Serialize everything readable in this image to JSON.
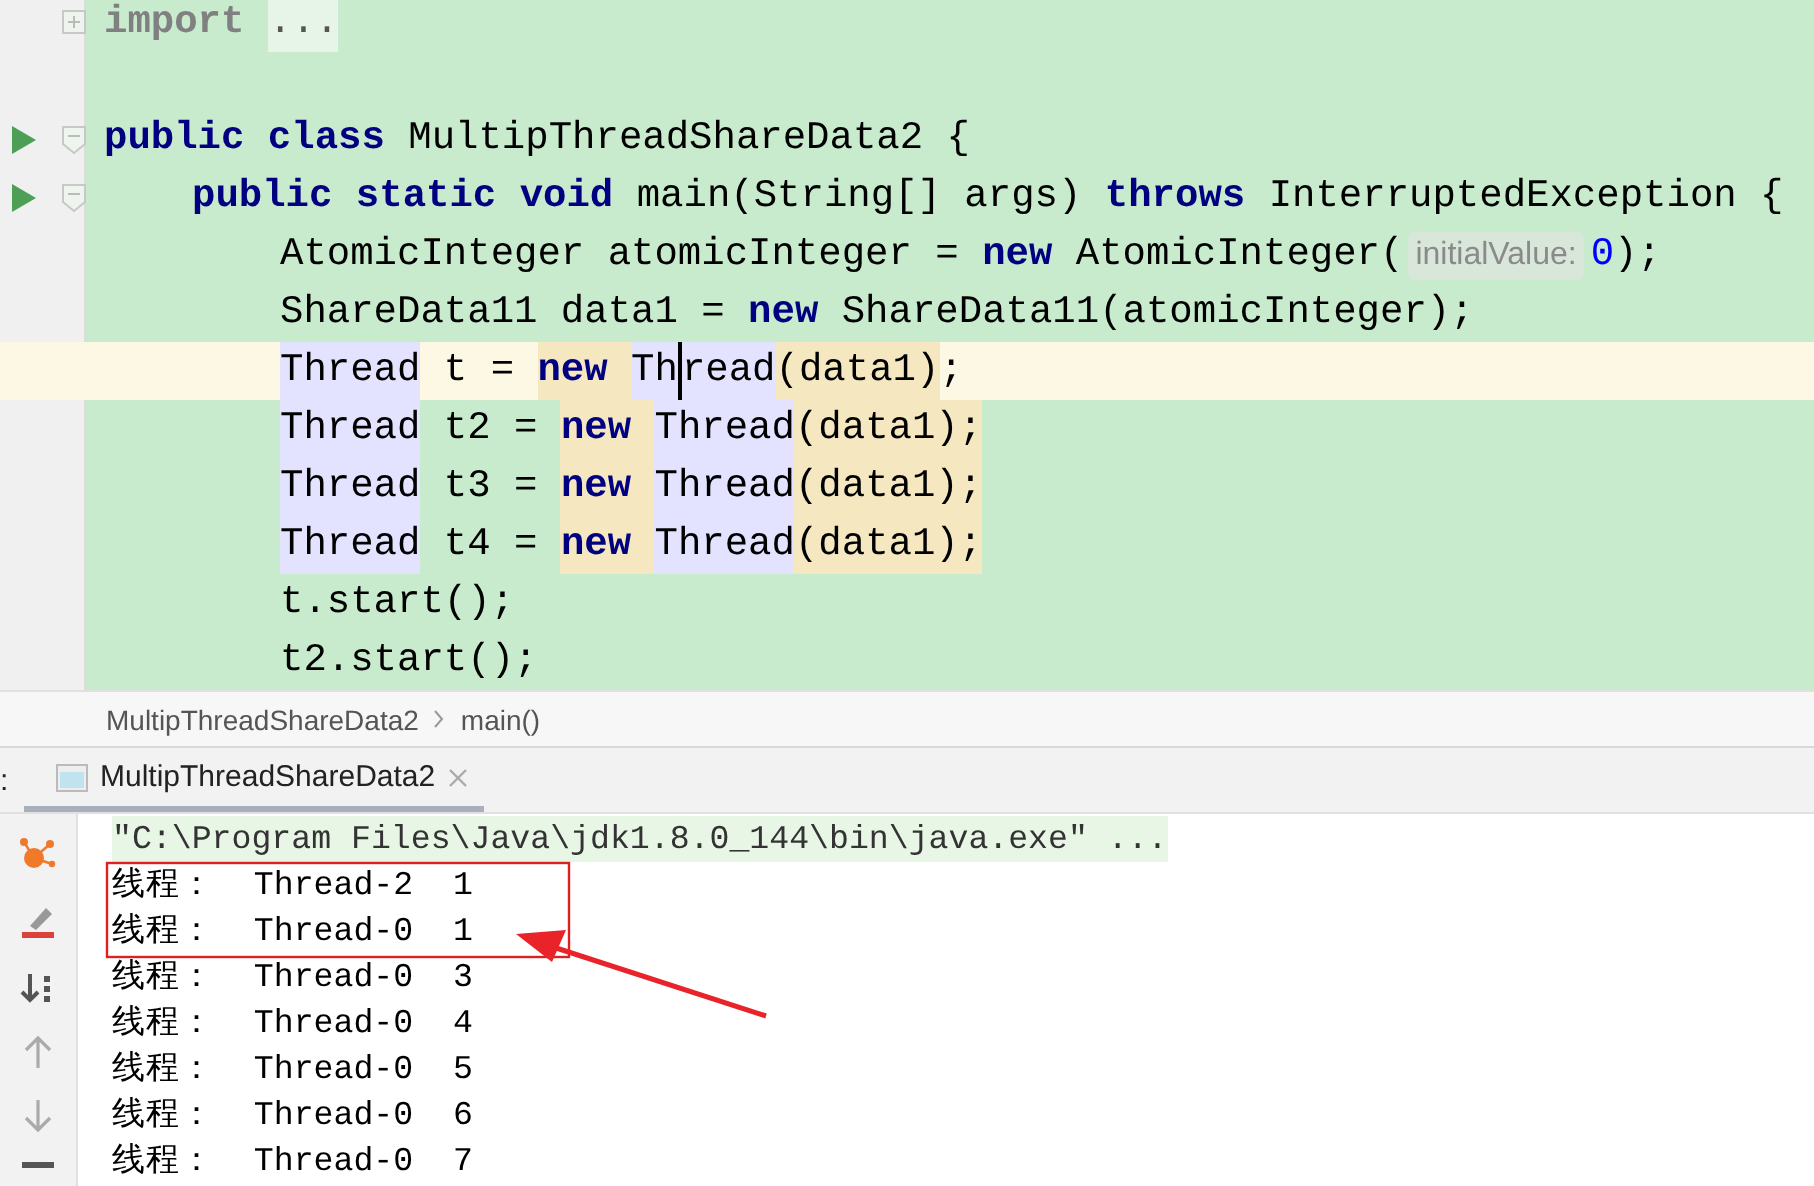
{
  "editor": {
    "lines": [
      {
        "collapsed": true,
        "tokens": [
          {
            "t": "import",
            "kind": "folded"
          },
          {
            "t": "...",
            "kind": "placeholder"
          }
        ]
      },
      {
        "run": true,
        "collapsed": false,
        "blank_before": true,
        "tokens": [
          {
            "t": "public class ",
            "kind": "keyword"
          },
          {
            "t": "MultipThreadShareData2 {",
            "kind": "plain"
          }
        ],
        "children": [
          {
            "run": true,
            "collapsed": false,
            "tokens": [
              {
                "t": "public static void ",
                "kind": "keyword"
              },
              {
                "t": "main(String[] args) ",
                "kind": "plain"
              },
              {
                "t": "throws ",
                "kind": "keyword"
              },
              {
                "t": "InterruptedException {",
                "kind": "plain"
              }
            ],
            "children": [
              {
                "tokens": [
                  {
                    "t": "AtomicInteger atomicInteger = ",
                    "kind": "plain"
                  },
                  {
                    "t": "new ",
                    "kind": "keyword"
                  },
                  {
                    "t": "AtomicInteger(",
                    "kind": "plain"
                  },
                  {
                    "t": "initialValue:",
                    "kind": "hint"
                  },
                  {
                    "t": "0",
                    "kind": "number"
                  },
                  {
                    "t": ");",
                    "kind": "plain"
                  }
                ]
              },
              {
                "tokens": [
                  {
                    "t": "ShareData11 data1 = ",
                    "kind": "plain"
                  },
                  {
                    "t": "new ",
                    "kind": "keyword"
                  },
                  {
                    "t": "ShareData11(atomicInteger);",
                    "kind": "plain"
                  }
                ]
              },
              {
                "current": true,
                "tokens": [
                  {
                    "t": "Thread",
                    "kind": "plain",
                    "usage_highlight": true
                  },
                  {
                    "t": " t = ",
                    "kind": "plain"
                  },
                  {
                    "t": "new ",
                    "kind": "keyword",
                    "write_highlight": true
                  },
                  {
                    "t": "Th",
                    "kind": "plain",
                    "usage_highlight": true
                  },
                  {
                    "t": "read",
                    "kind": "plain",
                    "usage_highlight": true,
                    "caret": true
                  },
                  {
                    "t": "(data1)",
                    "kind": "plain",
                    "write_highlight": true
                  },
                  {
                    "t": ";",
                    "kind": "plain"
                  }
                ]
              },
              {
                "tokens": [
                  {
                    "t": "Thread",
                    "kind": "plain",
                    "usage_highlight": true
                  },
                  {
                    "t": " t2 = ",
                    "kind": "plain"
                  },
                  {
                    "t": "new ",
                    "kind": "keyword",
                    "write_highlight": true
                  },
                  {
                    "t": "Thread",
                    "kind": "plain",
                    "usage_highlight": true
                  },
                  {
                    "t": "(data1);",
                    "kind": "plain",
                    "write_highlight": true
                  }
                ]
              },
              {
                "tokens": [
                  {
                    "t": "Thread",
                    "kind": "plain",
                    "usage_highlight": true
                  },
                  {
                    "t": " t3 = ",
                    "kind": "plain"
                  },
                  {
                    "t": "new ",
                    "kind": "keyword",
                    "write_highlight": true
                  },
                  {
                    "t": "Thread",
                    "kind": "plain",
                    "usage_highlight": true
                  },
                  {
                    "t": "(data1);",
                    "kind": "plain",
                    "write_highlight": true
                  }
                ]
              },
              {
                "tokens": [
                  {
                    "t": "Thread",
                    "kind": "plain",
                    "usage_highlight": true
                  },
                  {
                    "t": " t4 = ",
                    "kind": "plain"
                  },
                  {
                    "t": "new ",
                    "kind": "keyword",
                    "write_highlight": true
                  },
                  {
                    "t": "Thread",
                    "kind": "plain",
                    "usage_highlight": true
                  },
                  {
                    "t": "(data1);",
                    "kind": "plain",
                    "write_highlight": true
                  }
                ]
              },
              {
                "tokens": [
                  {
                    "t": "t.start();",
                    "kind": "plain"
                  }
                ]
              },
              {
                "tokens": [
                  {
                    "t": "t2.start();",
                    "kind": "plain"
                  }
                ]
              }
            ]
          }
        ]
      }
    ]
  },
  "breadcrumbs": [
    "MultipThreadShareData2",
    "main()"
  ],
  "run_panel": {
    "label_fragment": ":",
    "tabs": [
      {
        "title": "MultipThreadShareData2",
        "selected": true
      }
    ],
    "console": [
      {
        "kind": "command",
        "text": "\"C:\\Program Files\\Java\\jdk1.8.0_144\\bin\\java.exe\" ..."
      },
      {
        "kind": "output",
        "text": "线程：  Thread-2  1"
      },
      {
        "kind": "output",
        "text": "线程：  Thread-0  1"
      },
      {
        "kind": "output",
        "text": "线程：  Thread-0  3"
      },
      {
        "kind": "output",
        "text": "线程：  Thread-0  4"
      },
      {
        "kind": "output",
        "text": "线程：  Thread-0  5"
      },
      {
        "kind": "output",
        "text": "线程：  Thread-0  6"
      },
      {
        "kind": "output",
        "text": "线程：  Thread-0  7"
      }
    ]
  }
}
